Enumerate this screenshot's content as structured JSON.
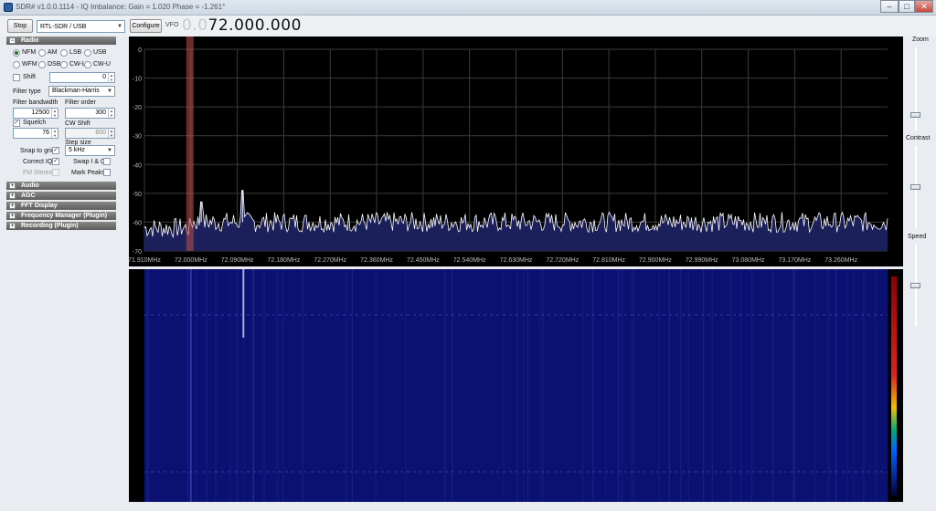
{
  "window": {
    "title": "SDR# v1.0.0.1114 - IQ Imbalance: Gain = 1.020 Phase = -1.261°",
    "title_faded_suffix": "",
    "minimize": "–",
    "maximize": "□",
    "close": "✕"
  },
  "toolbar": {
    "stop_label": "Stop",
    "device_value": "RTL-SDR / USB",
    "configure_label": "Configure",
    "vfo_label": "VFO",
    "vfo_dim": "0.0",
    "vfo_main": "72.000.000"
  },
  "radio": {
    "header": "Radio",
    "modes": [
      "NFM",
      "AM",
      "LSB",
      "USB",
      "WFM",
      "DSB",
      "CW-L",
      "CW-U"
    ],
    "selected_mode": "NFM",
    "shift_label": "Shift",
    "shift_value": "0",
    "filter_type_label": "Filter type",
    "filter_type_value": "Blackman-Harris",
    "filter_bandwidth_label": "Filter bandwidth",
    "filter_bandwidth_value": "12500",
    "filter_order_label": "Filter order",
    "filter_order_value": "300",
    "squelch_label": "Squelch",
    "squelch_value": "76",
    "cw_shift_label": "CW Shift",
    "cw_shift_value": "600",
    "step_size_label": "Step size",
    "step_size_value": "5 kHz",
    "snap_to_grid_label": "Snap to grid",
    "correct_iq_label": "Correct IQ",
    "swap_iq_label": "Swap I & Q",
    "fm_stereo_label": "FM Stereo",
    "mark_peaks_label": "Mark Peaks"
  },
  "sections": [
    "Audio",
    "AGC",
    "FFT Display",
    "Frequency Manager (Plugin)",
    "Recording (Plugin)"
  ],
  "right": {
    "zoom_label": "Zoom",
    "contrast_label": "Contrast",
    "speed_label": "Speed",
    "zoom_level": 0.2,
    "contrast_level": 0.5,
    "speed_level": 0.5
  },
  "colors": {
    "spectrum_fill": "#1b1f5a",
    "trace": "#ffffff",
    "grid": "#3b3b3b",
    "waterfall_bg": "#0a1170",
    "vfo_marker": "#c0504d"
  },
  "chart_data": {
    "type": "line",
    "xlabel": "",
    "ylabel": "",
    "ylim": [
      -70,
      0
    ],
    "yticks": [
      0,
      -10,
      -20,
      -30,
      -40,
      -50,
      -60,
      -70
    ],
    "xticks": [
      "71.910MHz",
      "72.000MHz",
      "72.090MHz",
      "72.180MHz",
      "72.270MHz",
      "72.360MHz",
      "72.450MHz",
      "72.540MHz",
      "72.630MHz",
      "72.720MHz",
      "72.810MHz",
      "72.900MHz",
      "72.990MHz",
      "73.080MHz",
      "73.170MHz",
      "73.260MHz"
    ],
    "xlim_mhz": [
      71.91,
      73.35
    ],
    "noise_floor_db": -60,
    "peaks": [
      {
        "x_mhz": 72.1,
        "y_db": -49
      },
      {
        "x_mhz": 72.02,
        "y_db": -53
      }
    ],
    "vfo_mhz": 72.0,
    "grid": true
  }
}
